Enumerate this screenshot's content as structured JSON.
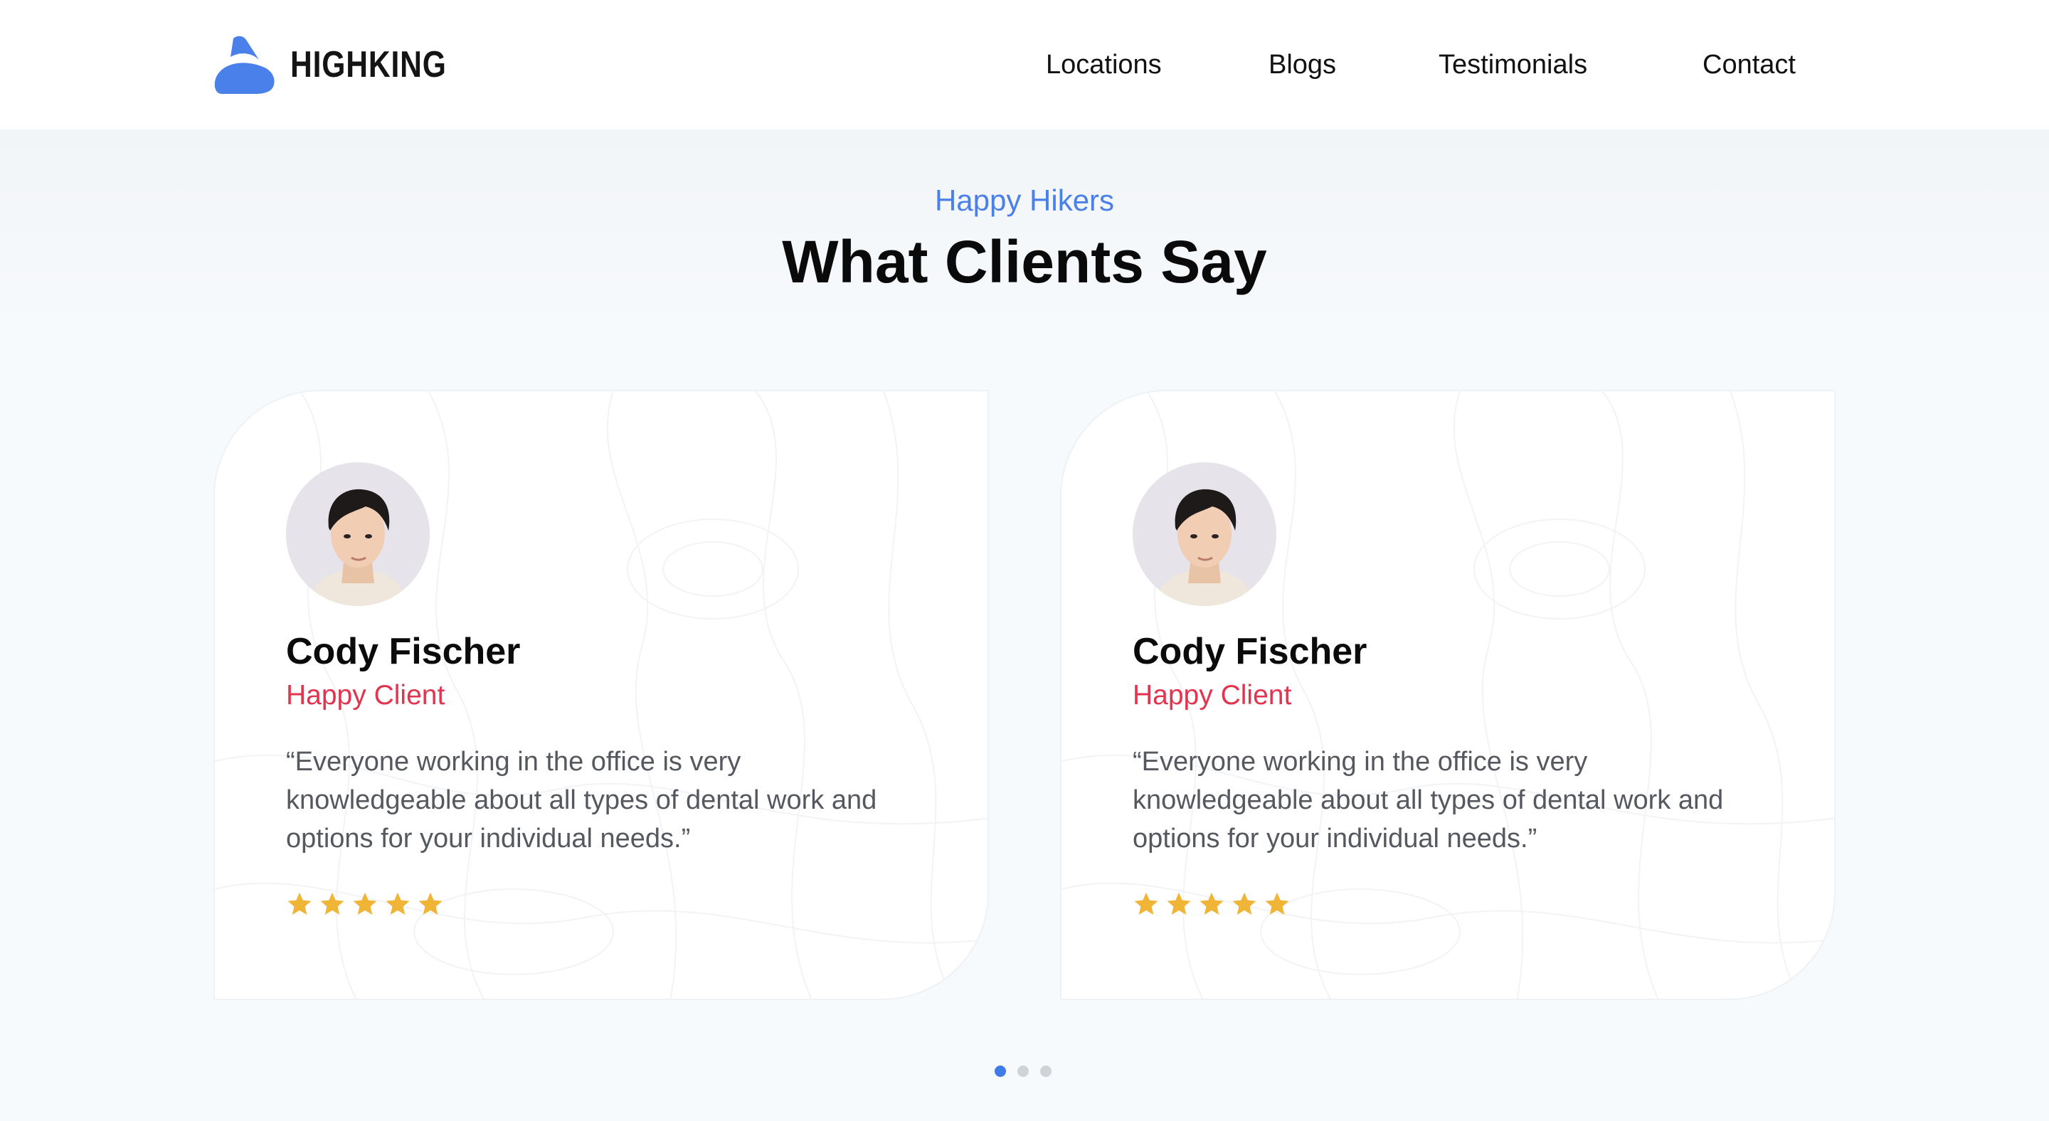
{
  "brand": {
    "name": "HIGHKING",
    "logo_icon": "mountain-logo-icon",
    "accent": "#4a80ea"
  },
  "nav": {
    "items": [
      {
        "label": "Locations"
      },
      {
        "label": "Blogs"
      },
      {
        "label": "Testimonials"
      },
      {
        "label": "Contact"
      }
    ]
  },
  "section": {
    "eyebrow": "Happy Hikers",
    "title": "What Clients Say"
  },
  "testimonials": [
    {
      "name": "Cody Fischer",
      "role": "Happy Client",
      "quote": "“Everyone working in the office is very knowledgeable about all types of dental work and options for your individual needs.”",
      "rating": 5,
      "rating_max": 5
    },
    {
      "name": "Cody Fischer",
      "role": "Happy Client",
      "quote": "“Everyone working in the office is very knowledgeable about all types of dental work and options for your individual needs.”",
      "rating": 5,
      "rating_max": 5
    }
  ],
  "carousel": {
    "pages": 3,
    "active_page": 1
  },
  "colors": {
    "role": "#e3344f",
    "star": "#f0b436",
    "dot_active": "#3f7be6",
    "dot_inactive": "#cfd3d8"
  }
}
